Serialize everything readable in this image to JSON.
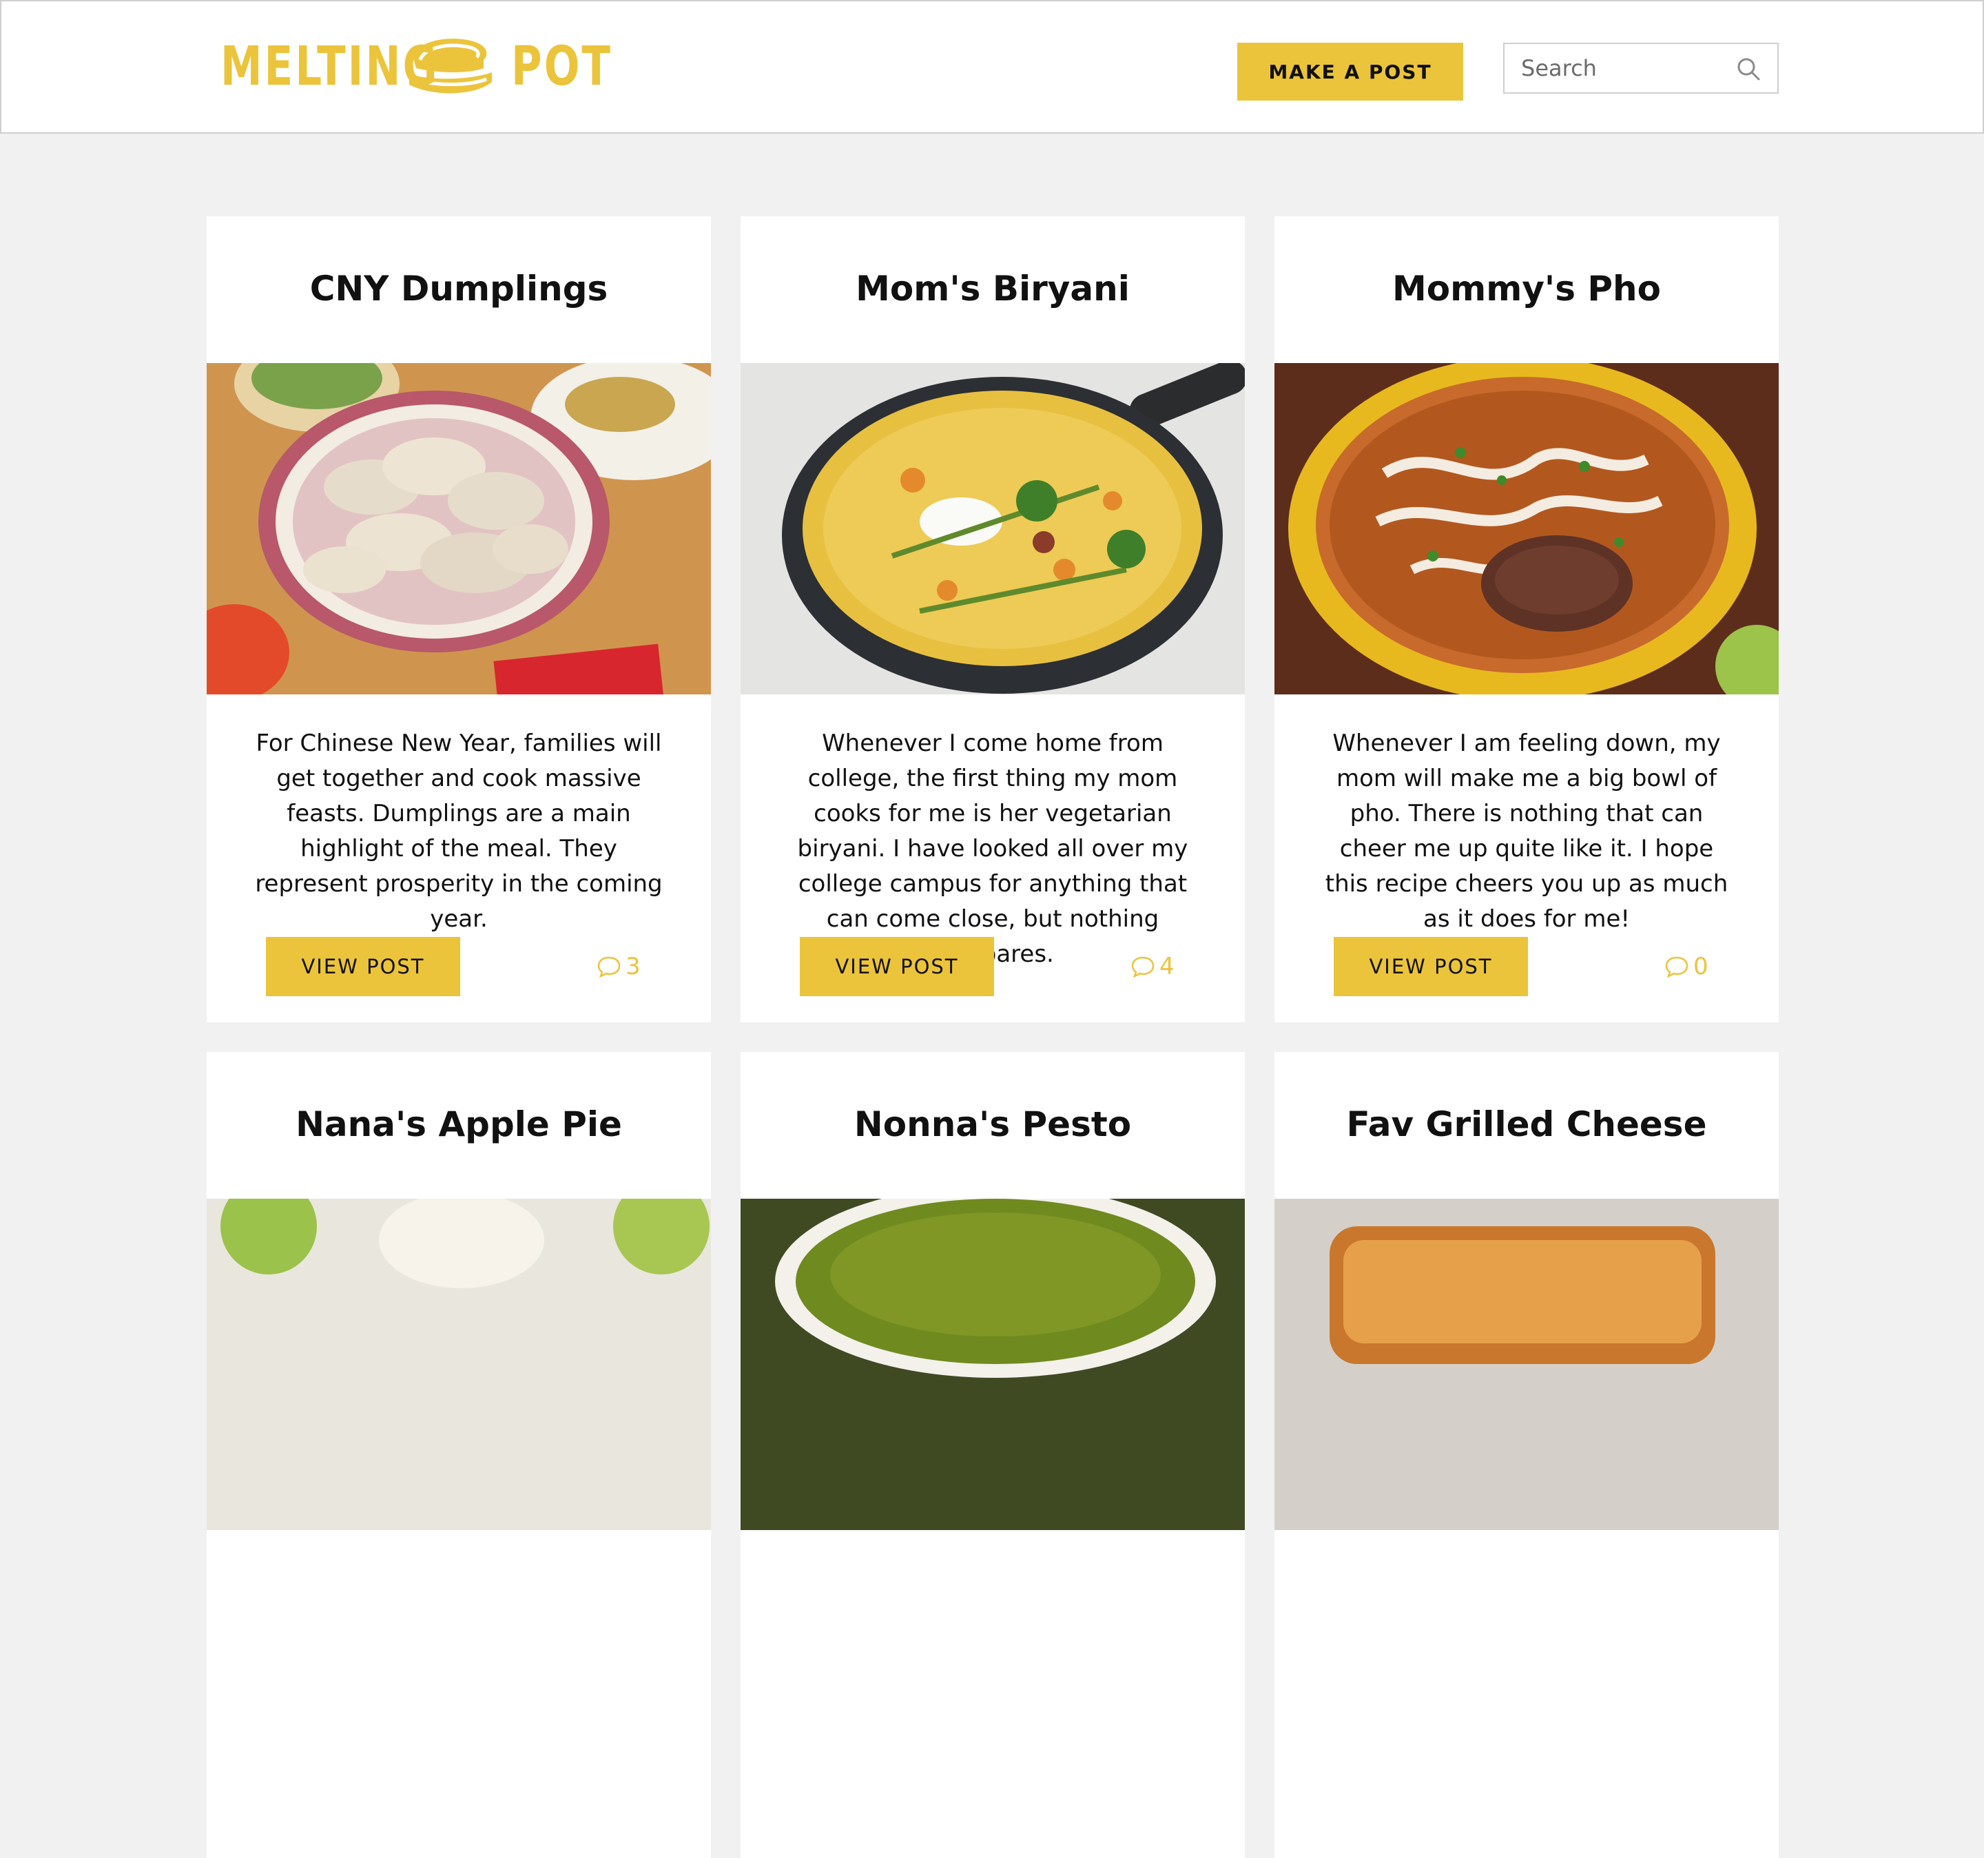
{
  "header": {
    "logo": {
      "word1": "MELTING",
      "word2": "POT"
    },
    "make_post_label": "MAKE A POST",
    "search_placeholder": "Search"
  },
  "colors": {
    "accent": "#ebc43b",
    "background": "#f1f1f1",
    "card": "#ffffff"
  },
  "posts": [
    {
      "title": "CNY Dumplings",
      "description": "For Chinese New Year, families will get together and cook massive feasts. Dumplings are a main highlight of the meal. They represent prosperity in the coming year.",
      "button": "VIEW POST",
      "comments": "3"
    },
    {
      "title": "Mom's Biryani",
      "description": "Whenever I come home from college, the first thing my mom cooks for me is her vegetarian biryani. I have looked all over my college campus for anything that can come close, but nothing compares.",
      "button": "VIEW POST",
      "comments": "4"
    },
    {
      "title": "Mommy's Pho",
      "description": "Whenever I am feeling down, my mom will make me a big bowl of pho. There is nothing that can cheer me up quite like it. I hope this recipe cheers you up as much as it does for me!",
      "button": "VIEW POST",
      "comments": "0"
    },
    {
      "title": "Nana's Apple Pie"
    },
    {
      "title": "Nonna's Pesto"
    },
    {
      "title": "Fav Grilled Cheese"
    }
  ]
}
